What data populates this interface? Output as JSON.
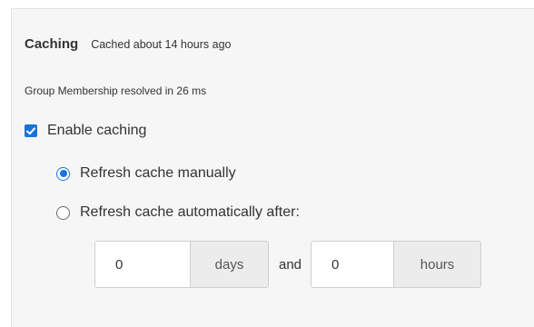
{
  "caching": {
    "title": "Caching",
    "status": "Cached about 14 hours ago",
    "resolve_time": "Group Membership resolved in 26 ms",
    "enable": {
      "label": "Enable caching",
      "checked": true
    },
    "refresh_options": [
      {
        "label": "Refresh cache manually",
        "selected": true
      },
      {
        "label": "Refresh cache automatically after:",
        "selected": false
      }
    ],
    "interval": {
      "days_value": "0",
      "days_unit": "days",
      "conjunction": "and",
      "hours_value": "0",
      "hours_unit": "hours"
    }
  },
  "icons": {
    "checkbox": "checkmark-icon"
  },
  "colors": {
    "accent": "#1a73d9",
    "panel_background": "#f6f6f6",
    "addon_background": "#ececec"
  }
}
